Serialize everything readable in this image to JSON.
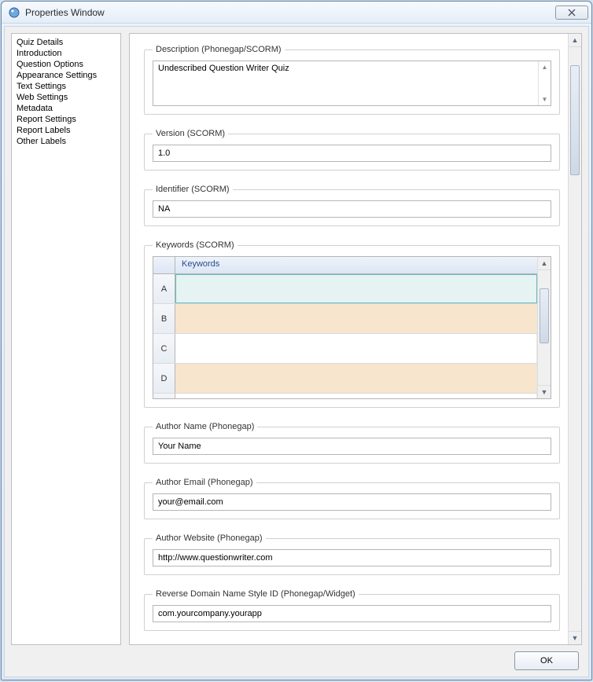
{
  "window": {
    "title": "Properties Window"
  },
  "sidebar": {
    "items": [
      "Quiz Details",
      "Introduction",
      "Question Options",
      "Appearance Settings",
      "Text Settings",
      "Web Settings",
      "Metadata",
      "Report Settings",
      "Report Labels",
      "Other Labels"
    ],
    "selected_index": 6
  },
  "form": {
    "description": {
      "label": "Description (Phonegap/SCORM)",
      "value": "Undescribed Question Writer Quiz"
    },
    "version": {
      "label": "Version (SCORM)",
      "value": "1.0"
    },
    "identifier": {
      "label": "Identifier (SCORM)",
      "value": "NA"
    },
    "keywords": {
      "label": "Keywords (SCORM)",
      "column_header": "Keywords",
      "rows": [
        {
          "hdr": "A",
          "value": ""
        },
        {
          "hdr": "B",
          "value": ""
        },
        {
          "hdr": "C",
          "value": ""
        },
        {
          "hdr": "D",
          "value": ""
        }
      ]
    },
    "author_name": {
      "label": "Author Name (Phonegap)",
      "value": "Your Name"
    },
    "author_email": {
      "label": "Author Email (Phonegap)",
      "value": "your@email.com"
    },
    "author_website": {
      "label": "Author Website (Phonegap)",
      "value": "http://www.questionwriter.com"
    },
    "reverse_domain": {
      "label": "Reverse Domain Name Style ID (Phonegap/Widget)",
      "value": "com.yourcompany.yourapp"
    }
  },
  "buttons": {
    "ok": "OK"
  }
}
